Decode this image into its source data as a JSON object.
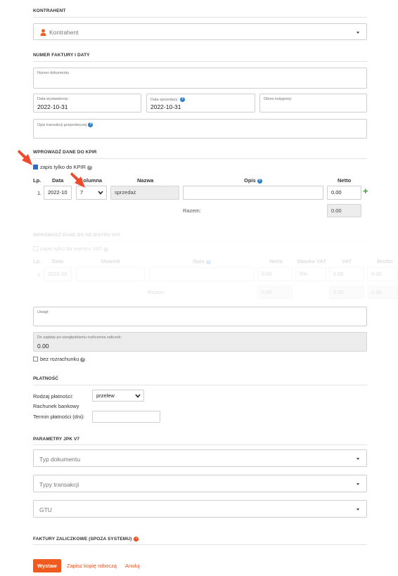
{
  "kontrahent": {
    "section_title": "KONTRAHENT",
    "placeholder": "Kontrahent"
  },
  "invoice": {
    "section_title": "NUMER FAKTURY I DATY",
    "number_label": "Numer dokumentu",
    "number_value": "",
    "issue_date_label": "Data wystawienia:",
    "issue_date": "2022-10-31",
    "sale_date_label": "Data sprzedaży:",
    "sale_date": "2022-10-31",
    "tax_period_label": "Okres księgowy:",
    "tax_period": "",
    "economic_desc_label": "Opis transakcji gospodarczej",
    "economic_desc": ""
  },
  "kpir": {
    "section_title": "WPROWADŹ DANE DO KPIR",
    "only_kpir_label": "zapis tylko do KPIR",
    "columns": {
      "lp": "Lp.",
      "date": "Data",
      "column": "Kolumna",
      "name": "Nazwa",
      "desc": "Opis",
      "net": "Netto"
    },
    "row": {
      "lp": "1.",
      "date": "2022-10",
      "column": "7",
      "name": "sprzedaż",
      "desc": "",
      "net": "0.00"
    },
    "total_label": "Razem:",
    "total_net": "0.00"
  },
  "vat": {
    "section_title": "WPROWADŹ DANE DO REJESTRU VAT",
    "only_vat_label": "zapis tylko do rejestru VAT",
    "columns": {
      "lp": "Lp.",
      "date": "Data",
      "dict": "Słownik",
      "desc": "Opis",
      "net": "Netto",
      "rate": "Stawka VAT",
      "vat": "VAT",
      "gross": "Brutto"
    },
    "row": {
      "lp": "1.",
      "date": "2022-10",
      "net": "0.00",
      "rate": "0%",
      "vat": "0.00",
      "gross": "0.00"
    },
    "total_label": "Razem:",
    "total_net": "0.00",
    "total_vat": "0.00",
    "total_gross": "0.00"
  },
  "notes": {
    "label": "Uwagi:",
    "to_pay_label": "Do zapłaty po uwzględnieniu rozliczenia zaliczek:",
    "to_pay_value": "0.00",
    "no_settlement_label": "bez rozrachunku"
  },
  "payment": {
    "section_title": "PŁATNOŚĆ",
    "type_label": "Rodzaj płatności:",
    "type_value": "przelew",
    "bank_label": "Rachunek bankowy",
    "due_label": "Termin płatności (dni):",
    "due_value": ""
  },
  "jpk": {
    "section_title": "PARAMETRY JPK V7",
    "doc_type_placeholder": "Typ dokumentu",
    "transaction_types_placeholder": "Typy transakcji",
    "gtu_placeholder": "GTU"
  },
  "advance": {
    "section_title": "FAKTURY ZALICZKOWE (SPOZA SYSTEMU)"
  },
  "actions": {
    "issue": "Wystaw",
    "save_draft": "Zapisz kopię roboczą",
    "cancel": "Anuluj"
  },
  "colors": {
    "accent": "#f15a1f",
    "help": "#2f7fc8",
    "add": "#3aa03a"
  }
}
